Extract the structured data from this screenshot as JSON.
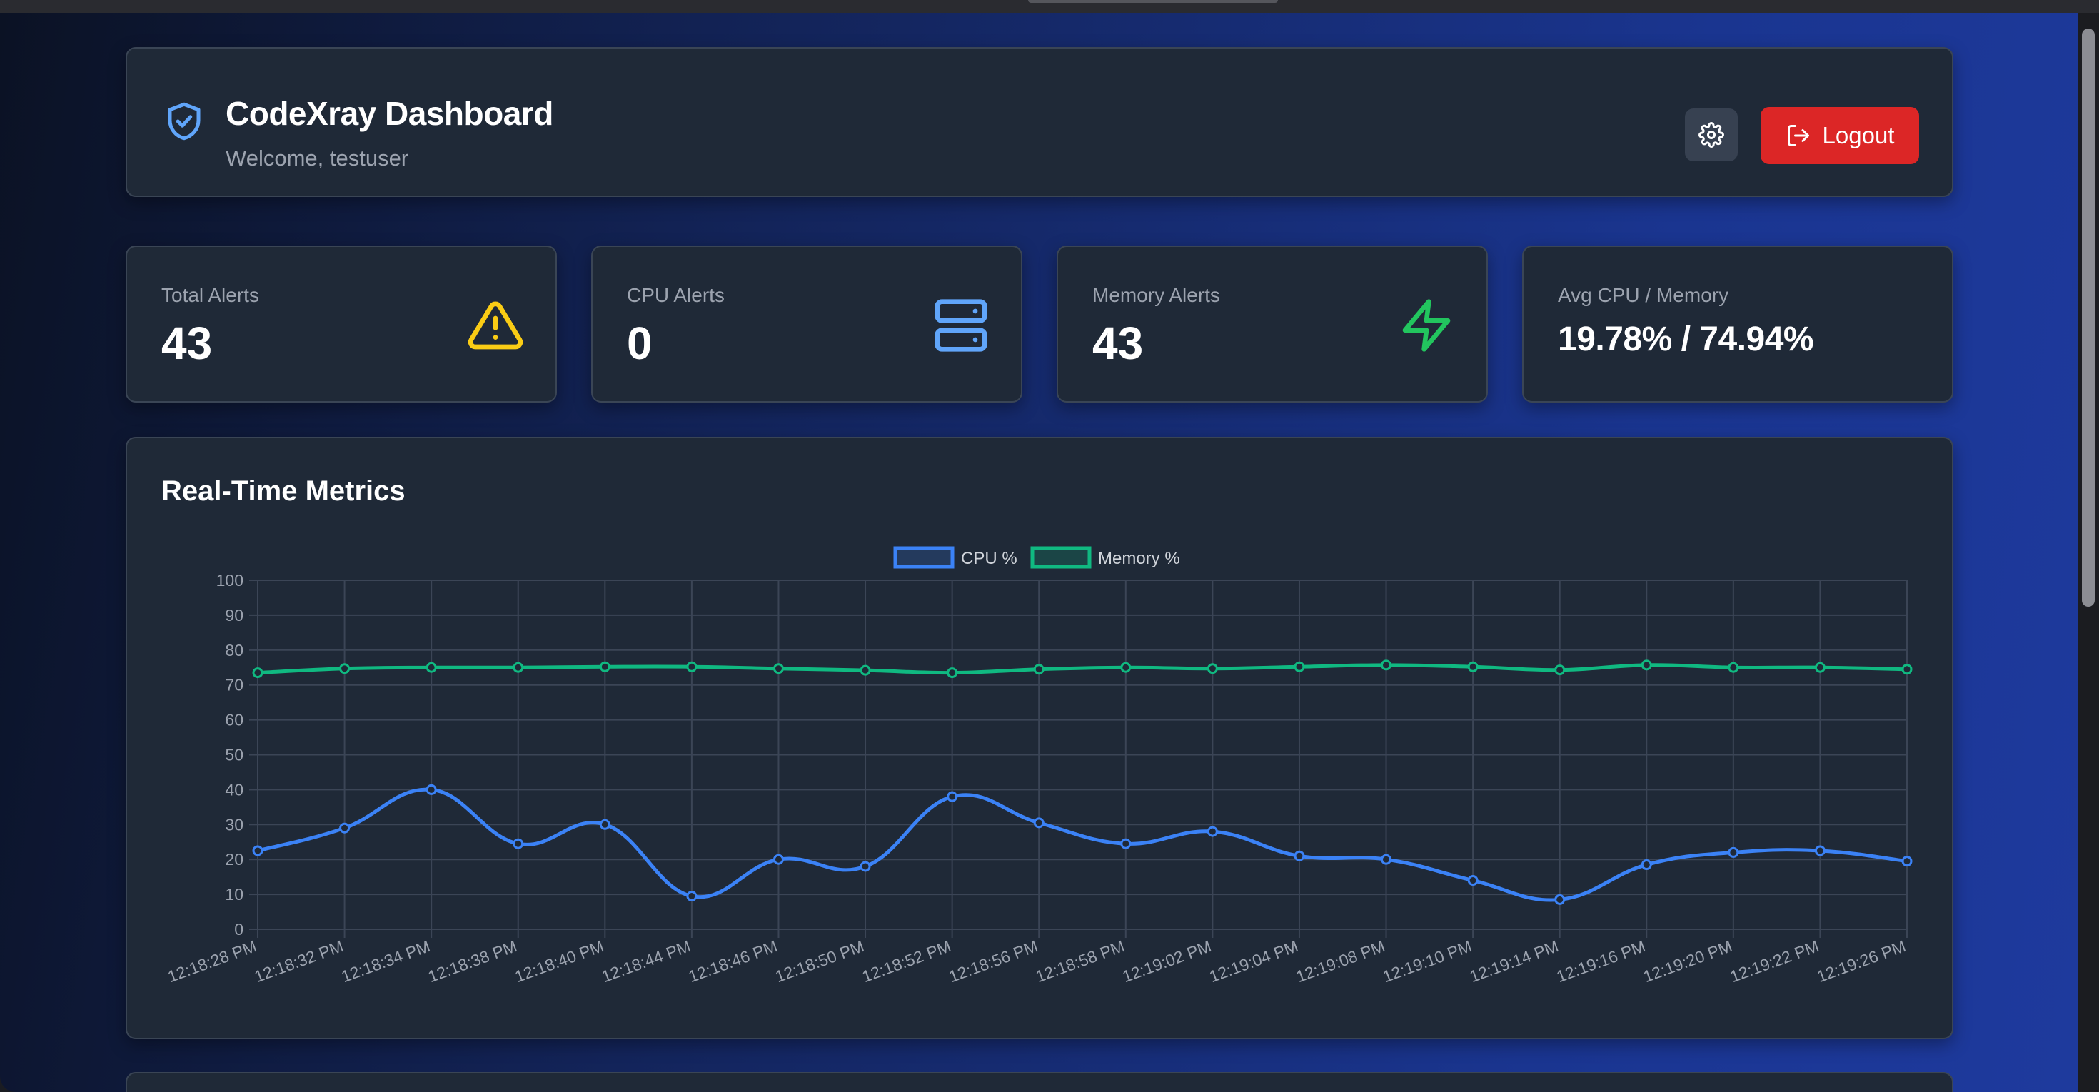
{
  "header": {
    "title": "CodeXray Dashboard",
    "welcome": "Welcome, testuser",
    "logout_label": "Logout",
    "icon": "shield-check-icon"
  },
  "stats": [
    {
      "label": "Total Alerts",
      "value": "43",
      "icon": "warning-triangle-icon",
      "icon_color": "#facc15"
    },
    {
      "label": "CPU Alerts",
      "value": "0",
      "icon": "server-icon",
      "icon_color": "#60a5fa"
    },
    {
      "label": "Memory Alerts",
      "value": "43",
      "icon": "lightning-icon",
      "icon_color": "#22c55e"
    },
    {
      "label": "Avg CPU / Memory",
      "value": "19.78% / 74.94%"
    }
  ],
  "colors": {
    "accent_blue": "#3b82f6",
    "accent_green": "#10b981",
    "danger": "#dc2626",
    "card_bg": "#1f2937"
  },
  "chart": {
    "title": "Real-Time Metrics"
  },
  "chart_data": {
    "type": "line",
    "title": "Real-Time Metrics",
    "x": [
      "12:18:28 PM",
      "12:18:32 PM",
      "12:18:34 PM",
      "12:18:38 PM",
      "12:18:40 PM",
      "12:18:44 PM",
      "12:18:46 PM",
      "12:18:50 PM",
      "12:18:52 PM",
      "12:18:56 PM",
      "12:18:58 PM",
      "12:19:02 PM",
      "12:19:04 PM",
      "12:19:08 PM",
      "12:19:10 PM",
      "12:19:14 PM",
      "12:19:16 PM",
      "12:19:20 PM",
      "12:19:22 PM",
      "12:19:26 PM"
    ],
    "series": [
      {
        "name": "CPU %",
        "color": "#3b82f6",
        "values": [
          22.5,
          29,
          40,
          24.5,
          30,
          9.5,
          20,
          18,
          38,
          30.5,
          24.5,
          28,
          21,
          20,
          14,
          8.5,
          18.5,
          22,
          22.5,
          19.5
        ]
      },
      {
        "name": "Memory %",
        "color": "#10b981",
        "values": [
          73.5,
          74.7,
          75,
          75,
          75.2,
          75.2,
          74.7,
          74.2,
          73.5,
          74.5,
          75,
          74.7,
          75.2,
          75.7,
          75.2,
          74.3,
          75.7,
          75,
          75,
          74.5
        ]
      }
    ],
    "ylim": [
      0,
      100
    ],
    "yticks": [
      0,
      10,
      20,
      30,
      40,
      50,
      60,
      70,
      80,
      90,
      100
    ],
    "grid": true,
    "legend": "top-center"
  }
}
